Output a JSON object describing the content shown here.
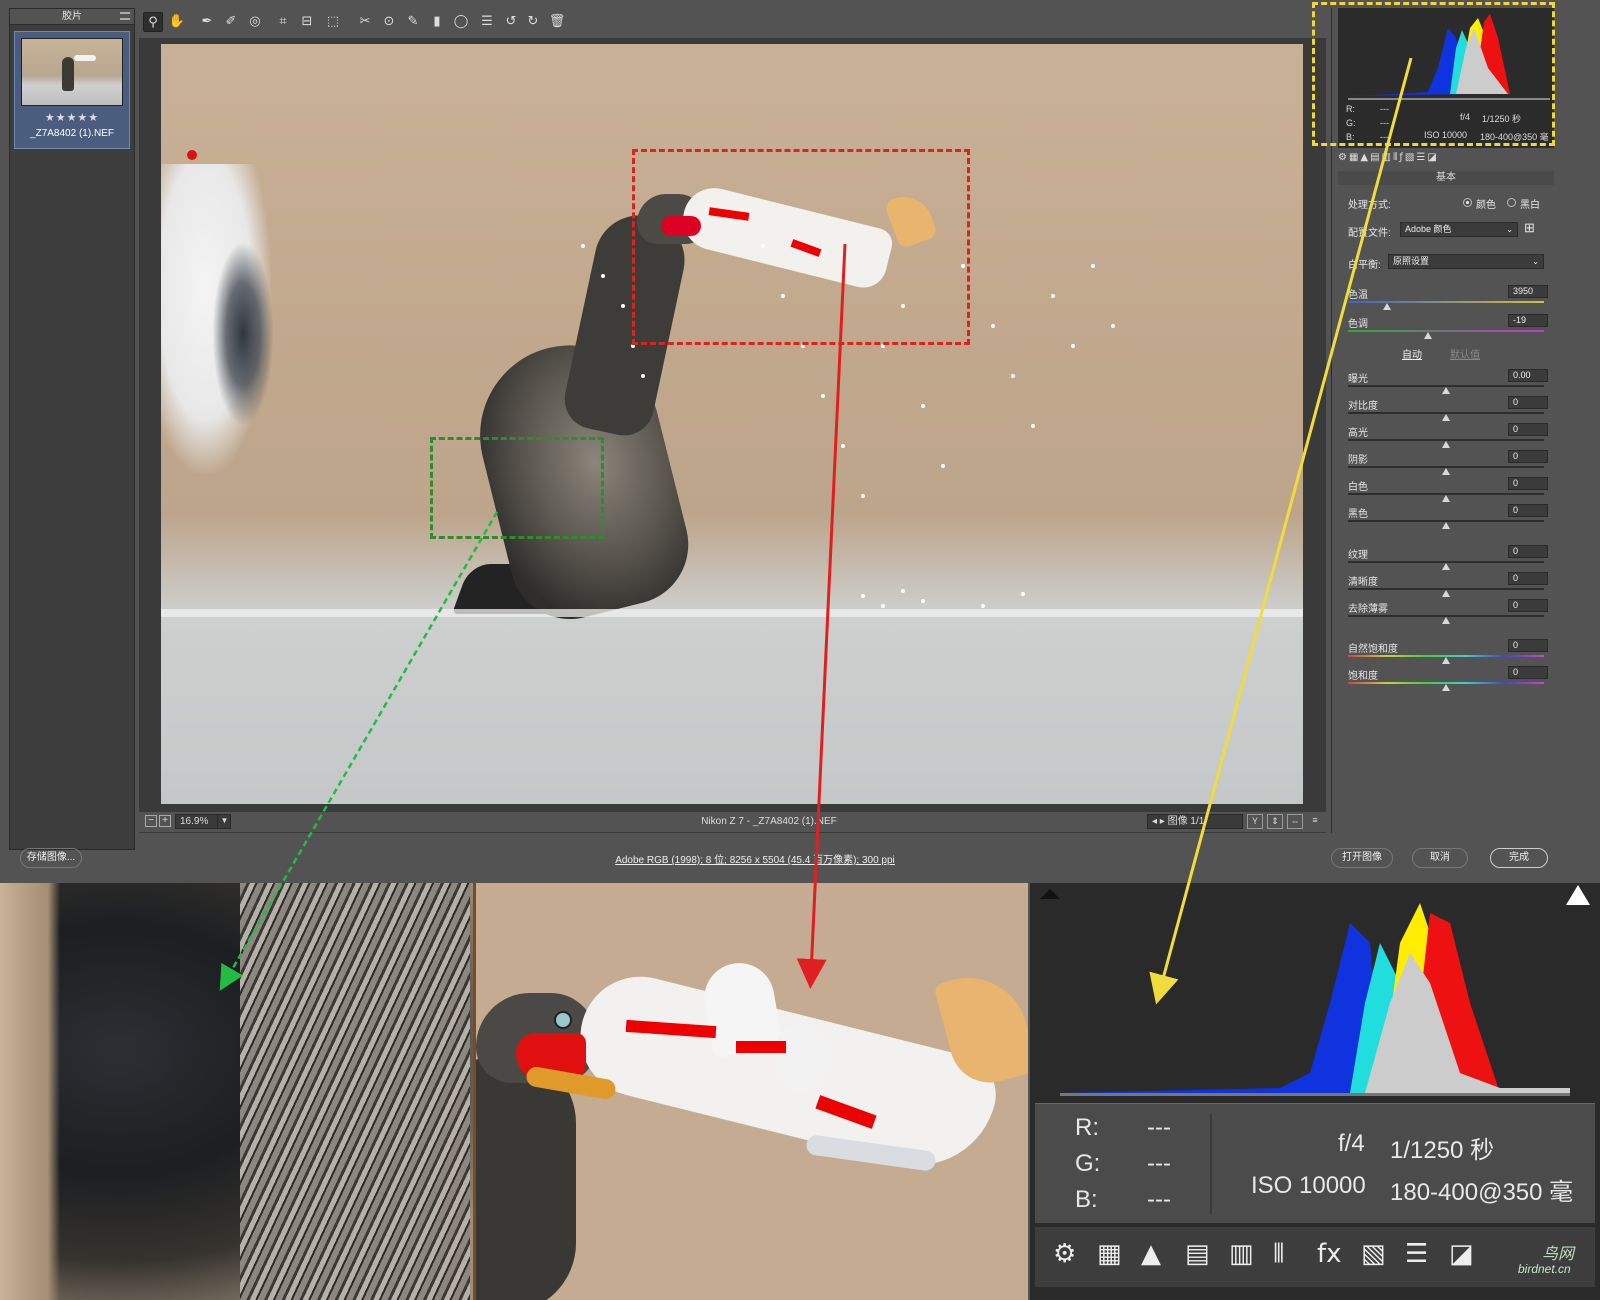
{
  "filmstrip": {
    "title": "胶片",
    "thumb_rating": "★★★★★",
    "thumb_filename": "_Z7A8402 (1).NEF"
  },
  "toolbar": {
    "tools": [
      "zoom-tool",
      "hand-tool",
      "white-balance-tool",
      "color-sampler-tool",
      "target-adjust-tool",
      "crop-tool",
      "straighten-tool",
      "transform-tool",
      "spot-removal-tool",
      "red-eye-tool",
      "adjustment-brush-tool",
      "graduated-filter-tool",
      "radial-filter-tool",
      "preferences-tool",
      "rotate-left-tool",
      "rotate-right-tool",
      "delete-tool"
    ],
    "glyphs": [
      "⚲",
      "✋",
      "✒",
      "✐",
      "◎",
      "⌗",
      "⊟",
      "⬚",
      "✂",
      "⊙",
      "✎",
      "▮",
      "◯",
      "☰",
      "↺",
      "↻",
      "🗑"
    ]
  },
  "statusbar": {
    "zoom": "16.9%",
    "caption": "Nikon Z 7 - _Z7A8402 (1).NEF",
    "image_nav": "图像 1/1",
    "view_btns": [
      "Y",
      "⇕",
      "⇔",
      "≡"
    ]
  },
  "histogram_mini": {
    "r_label": "R:",
    "g_label": "G:",
    "b_label": "B:",
    "r": "---",
    "g": "---",
    "b": "---",
    "aperture": "f/4",
    "shutter": "1/1250 秒",
    "iso": "ISO 10000",
    "lens": "180-400@350 毫"
  },
  "panel": {
    "section_title": "基本",
    "treatment_label": "处理方式:",
    "color_label": "颜色",
    "bw_label": "黑白",
    "profile_label": "配置文件:",
    "profile_value": "Adobe 颜色",
    "wb_label": "白平衡:",
    "wb_value": "原照设置",
    "auto_label": "自动",
    "default_label": "默认值",
    "sliders": [
      {
        "label": "色温",
        "value": "3950",
        "pos": 0.2
      },
      {
        "label": "色调",
        "value": "-19",
        "pos": 0.41
      },
      {
        "label": "曝光",
        "value": "0.00",
        "pos": 0.5
      },
      {
        "label": "对比度",
        "value": "0",
        "pos": 0.5
      },
      {
        "label": "高光",
        "value": "0",
        "pos": 0.5
      },
      {
        "label": "阴影",
        "value": "0",
        "pos": 0.5
      },
      {
        "label": "白色",
        "value": "0",
        "pos": 0.5
      },
      {
        "label": "黑色",
        "value": "0",
        "pos": 0.5
      },
      {
        "label": "纹理",
        "value": "0",
        "pos": 0.5
      },
      {
        "label": "清晰度",
        "value": "0",
        "pos": 0.5
      },
      {
        "label": "去除薄雾",
        "value": "0",
        "pos": 0.5
      },
      {
        "label": "自然饱和度",
        "value": "0",
        "pos": 0.5
      },
      {
        "label": "饱和度",
        "value": "0",
        "pos": 0.5
      }
    ]
  },
  "footer": {
    "save_label": "存储图像...",
    "info": "Adobe RGB (1998); 8 位; 8256 x 5504 (45.4 百万像素); 300 ppi",
    "open_label": "打开图像",
    "cancel_label": "取消",
    "done_label": "完成"
  },
  "zoom_histogram": {
    "r_label": "R:",
    "g_label": "G:",
    "b_label": "B:",
    "r": "---",
    "g": "---",
    "b": "---",
    "aperture": "f/4",
    "shutter": "1/1250 秒",
    "iso": "ISO 10000",
    "lens": "180-400@350 毫",
    "icons": [
      "⚙",
      "▦",
      "▲",
      "▤",
      "▥",
      "⦀",
      "fx",
      "▧",
      "☰",
      "◪"
    ]
  },
  "watermark": {
    "line1": "鸟网",
    "line2": "birdnet.cn"
  },
  "colors": {
    "red_box": "#dd2222",
    "green_box": "#2e8b2e",
    "yellow_box": "#f1d53a",
    "red_arrow": "#e02020",
    "green_arrow": "#22bb44",
    "yellow_arrow": "#f0dc3c"
  }
}
